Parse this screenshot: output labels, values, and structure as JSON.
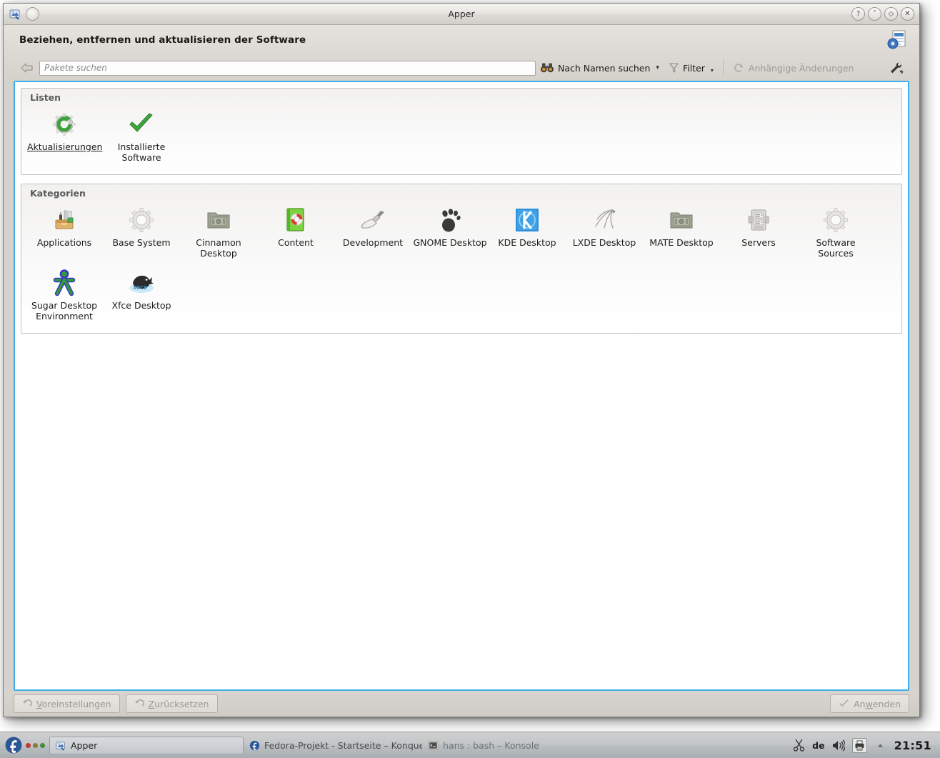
{
  "window": {
    "title": "Apper",
    "buttons": {
      "help": "?",
      "minimize": "˅",
      "maximize": "◇",
      "close": "✕"
    }
  },
  "header": {
    "caption": "Beziehen, entfernen und aktualisieren der Software"
  },
  "toolbar": {
    "search_placeholder": "Pakete suchen",
    "search_value": "",
    "search_mode_label": "Nach Namen suchen",
    "filter_label": "Filter",
    "pending_changes_label": "Anhängige Änderungen"
  },
  "lists": {
    "title": "Listen",
    "items": [
      {
        "label": "Aktualisierungen",
        "icon": "updates-gear-refresh-icon",
        "hovered": true
      },
      {
        "label": "Installierte Software",
        "icon": "installed-check-icon",
        "hovered": false
      }
    ]
  },
  "categories": {
    "title": "Kategorien",
    "items": [
      {
        "label": "Applications",
        "icon": "toolbox-icon"
      },
      {
        "label": "Base System",
        "icon": "gear-icon"
      },
      {
        "label": "Cinnamon Desktop",
        "icon": "package-folder-icon"
      },
      {
        "label": "Content",
        "icon": "green-book-lifebuoy-icon"
      },
      {
        "label": "Development",
        "icon": "trowel-icon"
      },
      {
        "label": "GNOME Desktop",
        "icon": "gnome-foot-icon"
      },
      {
        "label": "KDE Desktop",
        "icon": "kde-logo-icon"
      },
      {
        "label": "LXDE Desktop",
        "icon": "lxde-bird-icon"
      },
      {
        "label": "MATE Desktop",
        "icon": "package-folder-icon"
      },
      {
        "label": "Servers",
        "icon": "server-rack-icon"
      },
      {
        "label": "Software Sources",
        "icon": "gear-icon"
      },
      {
        "label": "Sugar Desktop Environment",
        "icon": "sugar-xo-icon"
      },
      {
        "label": "Xfce Desktop",
        "icon": "xfce-mouse-icon"
      }
    ]
  },
  "buttons": {
    "defaults": "Voreinstellungen",
    "reset": "Zurücksetzen",
    "apply": "Anwenden"
  },
  "taskbar": {
    "items": [
      {
        "label": "Apper",
        "active": true
      },
      {
        "label": "Fedora-Projekt - Startseite – Konquero",
        "active": false
      },
      {
        "label": "hans : bash – Konsole",
        "active": false
      }
    ],
    "tray": {
      "keyboard_layout": "de",
      "clock": "21:51"
    }
  },
  "colors": {
    "focus_border": "#3daee9",
    "window_bg": "#d6d2cd",
    "view_bg": "#ffffff",
    "taskbar_bg": "#b9bdc0"
  }
}
